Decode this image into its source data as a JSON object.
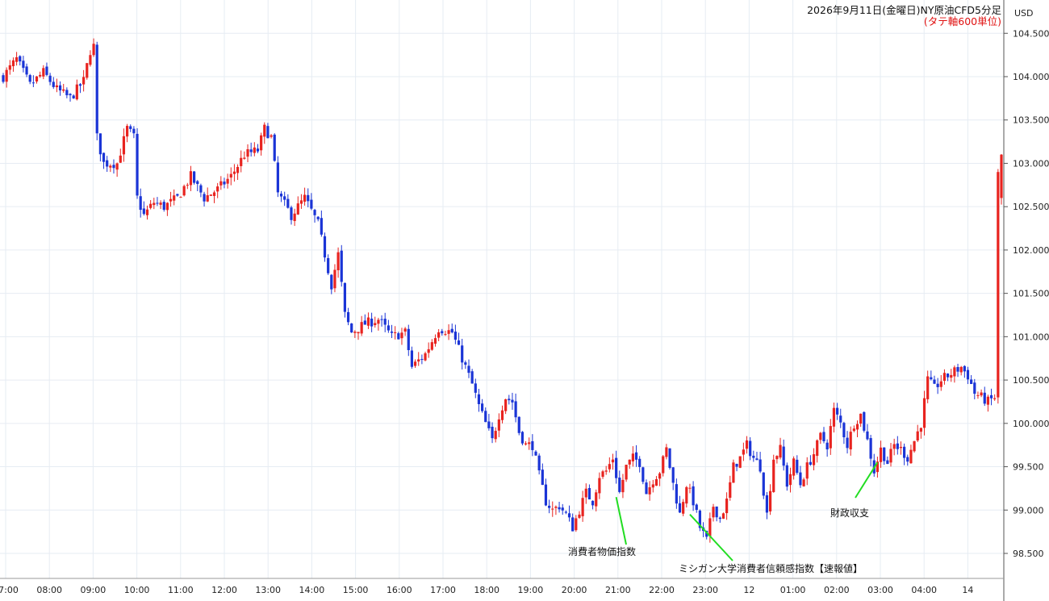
{
  "chart_data": {
    "type": "candlestick",
    "title": "2026年9月11日(金曜日)NY原油CFD5分足",
    "subtitle": "(タテ軸600単位)",
    "y_unit": "USD",
    "ylim": [
      98.3,
      104.8
    ],
    "y_ticks": [
      "98.500",
      "99.000",
      "99.500",
      "100.000",
      "100.500",
      "101.000",
      "101.500",
      "102.000",
      "102.500",
      "103.000",
      "103.500",
      "104.000",
      "104.500"
    ],
    "x_tick_labels": [
      "07:00",
      "08:00",
      "09:00",
      "10:00",
      "11:00",
      "12:00",
      "13:00",
      "14:00",
      "15:00",
      "16:00",
      "17:00",
      "18:00",
      "19:00",
      "20:00",
      "21:00",
      "22:00",
      "23:00",
      "12",
      "01:00",
      "02:00",
      "03:00",
      "04:00",
      "14"
    ],
    "grid": true,
    "colors": {
      "up": "#e8231f",
      "down": "#1a34d6",
      "annotation_line": "#22dd22",
      "grid": "#e6ecf3",
      "axis": "#555555",
      "subtitle": "#e01010"
    },
    "anchors": [
      [
        0,
        104.0
      ],
      [
        4,
        104.2
      ],
      [
        8,
        103.9
      ],
      [
        12,
        104.05
      ],
      [
        16,
        103.85
      ],
      [
        20,
        103.75
      ],
      [
        24,
        103.95
      ],
      [
        26,
        104.3
      ],
      [
        27,
        104.35
      ],
      [
        28,
        103.3
      ],
      [
        30,
        103.0
      ],
      [
        34,
        103.0
      ],
      [
        37,
        103.4
      ],
      [
        39,
        103.3
      ],
      [
        40,
        102.6
      ],
      [
        42,
        102.4
      ],
      [
        45,
        102.55
      ],
      [
        48,
        102.5
      ],
      [
        52,
        102.6
      ],
      [
        56,
        102.85
      ],
      [
        60,
        102.6
      ],
      [
        64,
        102.7
      ],
      [
        68,
        102.85
      ],
      [
        72,
        103.1
      ],
      [
        76,
        103.15
      ],
      [
        78,
        103.4
      ],
      [
        80,
        103.3
      ],
      [
        82,
        102.65
      ],
      [
        86,
        102.4
      ],
      [
        90,
        102.6
      ],
      [
        94,
        102.3
      ],
      [
        96,
        101.95
      ],
      [
        98,
        101.6
      ],
      [
        100,
        101.95
      ],
      [
        102,
        101.25
      ],
      [
        104,
        101.05
      ],
      [
        108,
        101.15
      ],
      [
        112,
        101.2
      ],
      [
        116,
        101.0
      ],
      [
        120,
        101.05
      ],
      [
        122,
        100.65
      ],
      [
        126,
        100.8
      ],
      [
        130,
        101.1
      ],
      [
        134,
        101.05
      ],
      [
        136,
        100.85
      ],
      [
        138,
        100.65
      ],
      [
        140,
        100.45
      ],
      [
        142,
        100.2
      ],
      [
        144,
        100.0
      ],
      [
        146,
        99.8
      ],
      [
        148,
        100.1
      ],
      [
        150,
        100.3
      ],
      [
        152,
        100.25
      ],
      [
        154,
        99.9
      ],
      [
        156,
        99.75
      ],
      [
        158,
        99.75
      ],
      [
        160,
        99.4
      ],
      [
        162,
        99.1
      ],
      [
        164,
        99.0
      ],
      [
        166,
        99.05
      ],
      [
        168,
        98.95
      ],
      [
        170,
        98.8
      ],
      [
        172,
        99.0
      ],
      [
        174,
        99.2
      ],
      [
        176,
        99.1
      ],
      [
        178,
        99.4
      ],
      [
        180,
        99.45
      ],
      [
        182,
        99.6
      ],
      [
        184,
        99.2
      ],
      [
        186,
        99.5
      ],
      [
        188,
        99.6
      ],
      [
        190,
        99.55
      ],
      [
        192,
        99.2
      ],
      [
        194,
        99.35
      ],
      [
        196,
        99.45
      ],
      [
        198,
        99.7
      ],
      [
        200,
        99.3
      ],
      [
        202,
        98.95
      ],
      [
        204,
        99.3
      ],
      [
        206,
        99.1
      ],
      [
        208,
        98.8
      ],
      [
        210,
        98.65
      ],
      [
        212,
        99.05
      ],
      [
        214,
        98.9
      ],
      [
        216,
        99.1
      ],
      [
        218,
        99.5
      ],
      [
        220,
        99.6
      ],
      [
        222,
        99.75
      ],
      [
        224,
        99.6
      ],
      [
        226,
        99.5
      ],
      [
        228,
        98.95
      ],
      [
        230,
        99.6
      ],
      [
        232,
        99.7
      ],
      [
        234,
        99.3
      ],
      [
        236,
        99.55
      ],
      [
        238,
        99.3
      ],
      [
        240,
        99.5
      ],
      [
        242,
        99.65
      ],
      [
        244,
        99.85
      ],
      [
        246,
        99.75
      ],
      [
        248,
        100.15
      ],
      [
        250,
        100.0
      ],
      [
        252,
        99.75
      ],
      [
        254,
        100.0
      ],
      [
        256,
        100.1
      ],
      [
        258,
        99.8
      ],
      [
        260,
        99.45
      ],
      [
        262,
        99.7
      ],
      [
        264,
        99.55
      ],
      [
        266,
        99.75
      ],
      [
        268,
        99.7
      ],
      [
        270,
        99.6
      ],
      [
        272,
        99.8
      ],
      [
        274,
        100.0
      ],
      [
        276,
        100.5
      ],
      [
        278,
        100.4
      ],
      [
        280,
        100.5
      ],
      [
        282,
        100.55
      ],
      [
        284,
        100.6
      ],
      [
        286,
        100.65
      ],
      [
        288,
        100.55
      ],
      [
        290,
        100.35
      ],
      [
        292,
        100.3
      ],
      [
        294,
        100.25
      ],
      [
        296,
        100.3
      ],
      [
        297,
        102.9
      ],
      [
        298,
        103.1
      ]
    ],
    "candle_count": 299,
    "annotations": [
      {
        "label": "消費者物価指数",
        "candle": 183,
        "value": 99.15
      },
      {
        "label": "ミシガン大学消費者信頼感指数【速報値】",
        "candle": 205,
        "value": 98.95
      },
      {
        "label": "財政収支",
        "candle": 261,
        "value": 99.55
      }
    ]
  }
}
